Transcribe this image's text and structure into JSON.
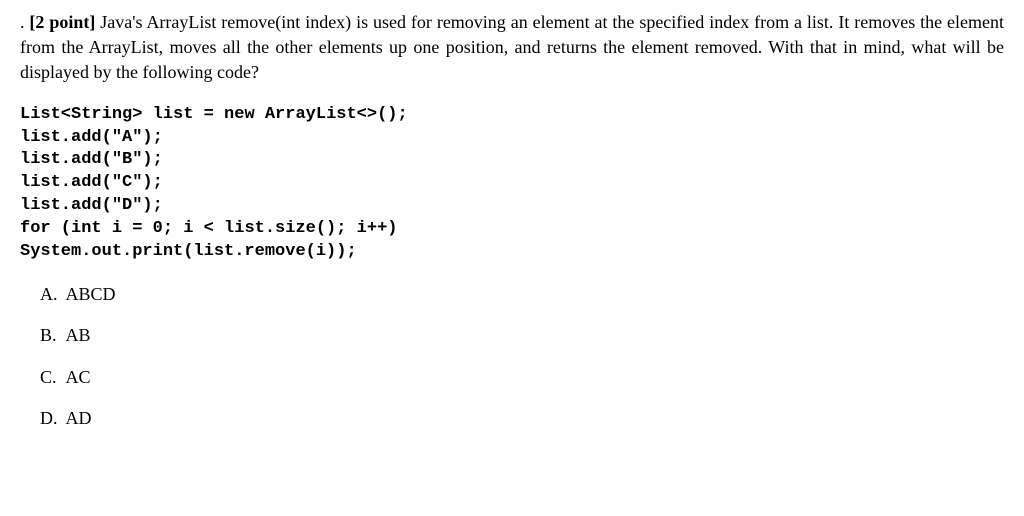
{
  "question": {
    "prefix": ".",
    "points": "[2 point]",
    "text": "Java's ArrayList remove(int index) is used for removing an element at the specified index from a list. It removes the element from the ArrayList, moves all the other elements up one position, and returns the element removed. With that in mind, what will be displayed by the following code?"
  },
  "code": {
    "line1a": "List<String> list = ",
    "line1kw": "new",
    "line1b": " ArrayList<>();",
    "line2": "list.add(\"A\");",
    "line3": "list.add(\"B\");",
    "line4": "list.add(\"C\");",
    "line5": "list.add(\"D\");",
    "line6kw": "for",
    "line6a": " (",
    "line6kw2": "int",
    "line6b": " i = 0; i < list.size(); i++)",
    "line7": "System.out.print(list.remove(i));"
  },
  "options": [
    {
      "label": "A.",
      "text": "ABCD"
    },
    {
      "label": "B.",
      "text": "AB"
    },
    {
      "label": "C.",
      "text": "AC"
    },
    {
      "label": "D.",
      "text": "AD"
    }
  ]
}
